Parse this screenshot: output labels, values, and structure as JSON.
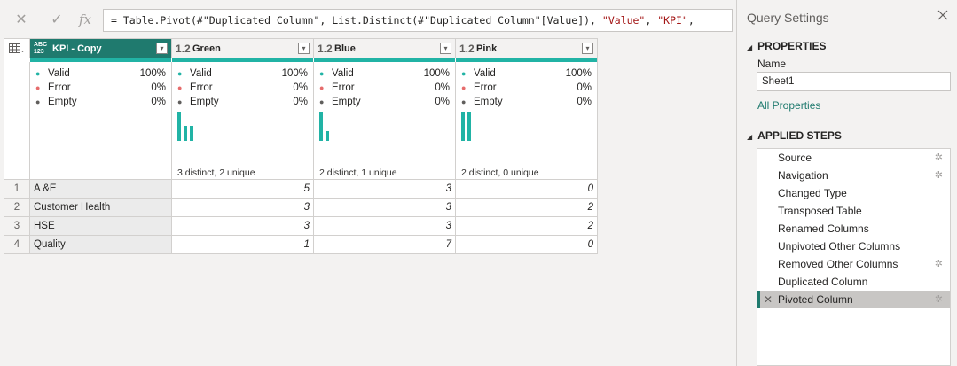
{
  "formula_bar": {
    "cancel_icon": "✕",
    "commit_icon": "✓",
    "fx_icon": "fx",
    "formula_prefix": "= Table.Pivot(#\"Duplicated Column\", List.Distinct(#\"Duplicated Column\"[Value]), ",
    "formula_str1": "\"Value\"",
    "formula_sep": ", ",
    "formula_str2": "\"KPI\"",
    "formula_suffix": ",",
    "expand_icon": "chevron-down-icon"
  },
  "grid": {
    "columns": [
      {
        "type_label": "ABC\n123",
        "name": "KPI - Copy",
        "selected": true,
        "quality": {
          "valid_label": "Valid",
          "valid_pct": "100%",
          "error_label": "Error",
          "error_pct": "0%",
          "empty_label": "Empty",
          "empty_pct": "0%"
        },
        "distinct_text": ""
      },
      {
        "type_label": "1.2",
        "name": "Green",
        "quality": {
          "valid_label": "Valid",
          "valid_pct": "100%",
          "error_label": "Error",
          "error_pct": "0%",
          "empty_label": "Empty",
          "empty_pct": "0%"
        },
        "histogram": [
          1,
          0.5,
          0.5
        ],
        "distinct_text": "3 distinct, 2 unique"
      },
      {
        "type_label": "1.2",
        "name": "Blue",
        "quality": {
          "valid_label": "Valid",
          "valid_pct": "100%",
          "error_label": "Error",
          "error_pct": "0%",
          "empty_label": "Empty",
          "empty_pct": "0%"
        },
        "histogram": [
          1,
          0.33
        ],
        "distinct_text": "2 distinct, 1 unique"
      },
      {
        "type_label": "1.2",
        "name": "Pink",
        "quality": {
          "valid_label": "Valid",
          "valid_pct": "100%",
          "error_label": "Error",
          "error_pct": "0%",
          "empty_label": "Empty",
          "empty_pct": "0%"
        },
        "histogram": [
          1,
          1
        ],
        "distinct_text": "2 distinct, 0 unique"
      }
    ],
    "rows": [
      {
        "n": "1",
        "kpi": "A &E",
        "green": "5",
        "blue": "3",
        "pink": "0"
      },
      {
        "n": "2",
        "kpi": "Customer Health",
        "green": "3",
        "blue": "3",
        "pink": "2"
      },
      {
        "n": "3",
        "kpi": "HSE",
        "green": "3",
        "blue": "3",
        "pink": "2"
      },
      {
        "n": "4",
        "kpi": "Quality",
        "green": "1",
        "blue": "7",
        "pink": "0"
      }
    ],
    "colors": {
      "valid": "#21b3a5",
      "error": "#e66c6c",
      "empty": "#605e5c",
      "accent": "#1f7a6e"
    }
  },
  "query_settings": {
    "title": "Query Settings",
    "properties_header": "PROPERTIES",
    "name_label": "Name",
    "name_value": "Sheet1",
    "all_properties_link": "All Properties",
    "applied_steps_header": "APPLIED STEPS",
    "steps": [
      {
        "label": "Source",
        "gear": true
      },
      {
        "label": "Navigation",
        "gear": true
      },
      {
        "label": "Changed Type",
        "gear": false
      },
      {
        "label": "Transposed Table",
        "gear": false
      },
      {
        "label": "Renamed Columns",
        "gear": false
      },
      {
        "label": "Unpivoted Other Columns",
        "gear": false
      },
      {
        "label": "Removed Other Columns",
        "gear": true
      },
      {
        "label": "Duplicated Column",
        "gear": false
      },
      {
        "label": "Pivoted Column",
        "gear": true,
        "active": true
      }
    ]
  }
}
